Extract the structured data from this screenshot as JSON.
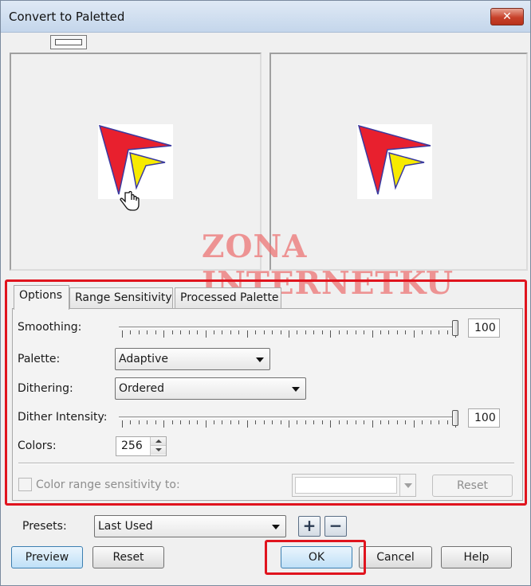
{
  "window": {
    "title": "Convert to Paletted",
    "close_glyph": "✕"
  },
  "watermark": "ZONA INTERNETKU",
  "tabs": [
    {
      "label": "Options",
      "active": true
    },
    {
      "label": "Range Sensitivity",
      "active": false
    },
    {
      "label": "Processed Palette",
      "active": false
    }
  ],
  "options": {
    "smoothing_label": "Smoothing:",
    "smoothing_value": "100",
    "palette_label": "Palette:",
    "palette_value": "Adaptive",
    "dithering_label": "Dithering:",
    "dithering_value": "Ordered",
    "dither_intensity_label": "Dither Intensity:",
    "dither_intensity_value": "100",
    "colors_label": "Colors:",
    "colors_value": "256",
    "color_range_label": "Color range sensitivity to:",
    "color_range_checked": false,
    "reset_label": "Reset"
  },
  "presets": {
    "label": "Presets:",
    "value": "Last Used",
    "add_glyph": "+",
    "remove_glyph": "−"
  },
  "buttons": {
    "preview": "Preview",
    "reset": "Reset",
    "ok": "OK",
    "cancel": "Cancel",
    "help": "Help"
  },
  "icons": [
    "close-icon",
    "split-view-icon",
    "hand-cursor-icon",
    "dropdown-arrow-icon",
    "spin-up-icon",
    "spin-down-icon",
    "add-preset-icon",
    "remove-preset-icon"
  ],
  "colors": {
    "highlight": "#e0141e",
    "shape_red": "#e8202e",
    "shape_yellow": "#f7ea00",
    "shape_outline": "#3a3aa0",
    "watermark": "#ec7878"
  }
}
